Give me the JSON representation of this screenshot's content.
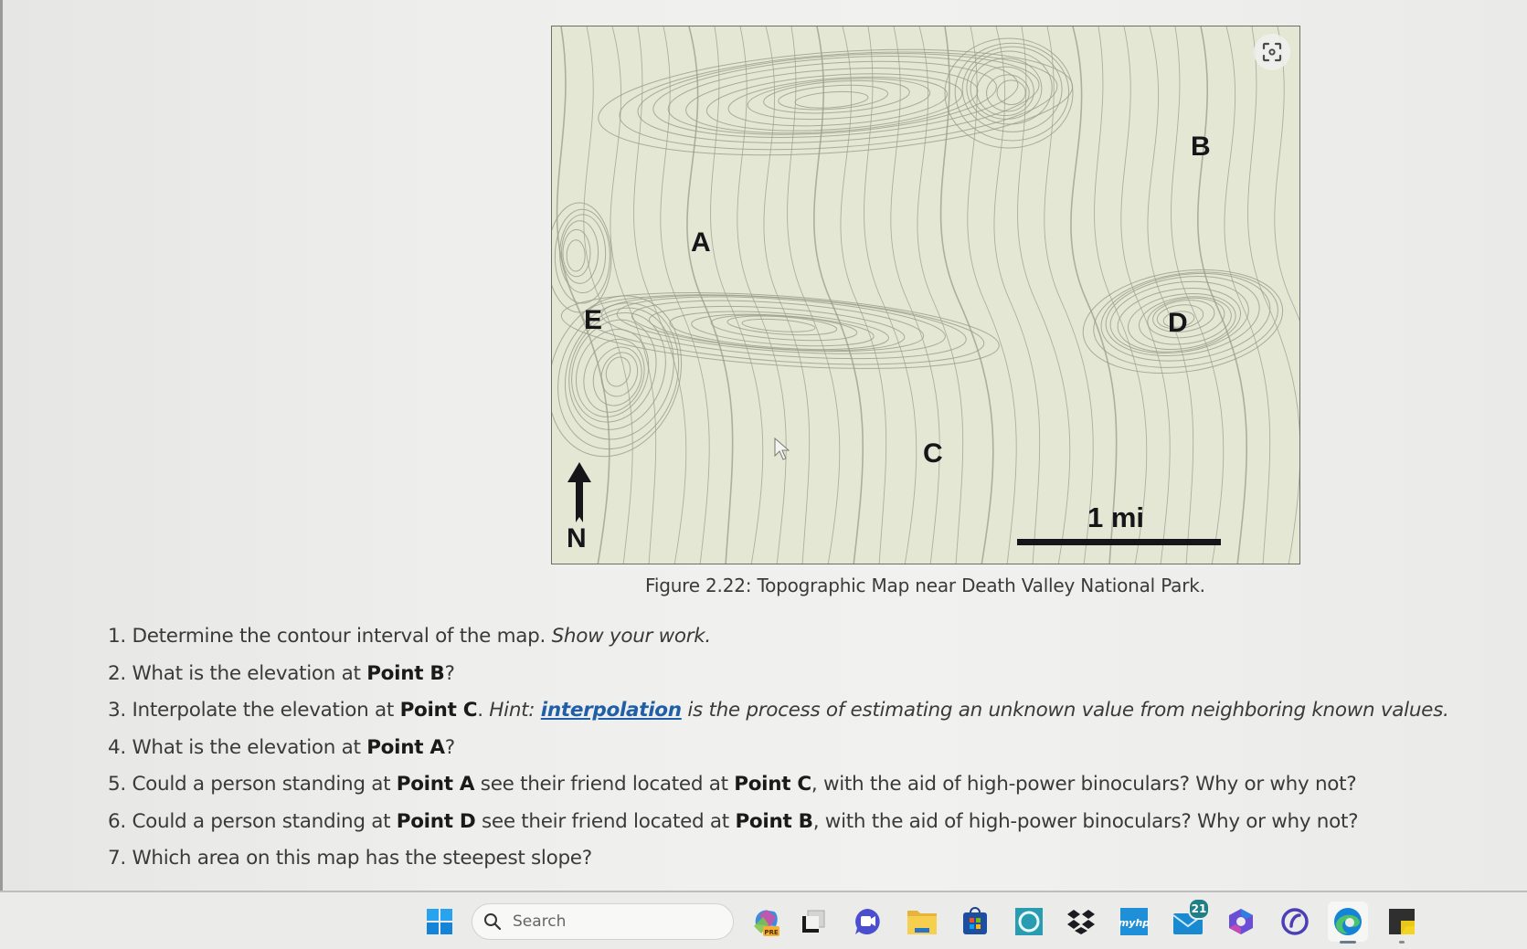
{
  "figure": {
    "caption": "Figure 2.22: Topographic Map near Death Valley National Park.",
    "point_labels": {
      "A": "A",
      "B": "B",
      "C": "C",
      "D": "D",
      "E": "E"
    },
    "north_label": "N",
    "scale_label": "1 mi",
    "colors": {
      "map_background": "#e4e7d3",
      "contour": "#9a9c8c",
      "label": "#16161a"
    }
  },
  "questions": [
    {
      "number": "1.",
      "parts": [
        {
          "t": "Determine the contour interval of the map. "
        },
        {
          "t": "Show your work.",
          "style": "italic"
        }
      ]
    },
    {
      "number": "2.",
      "parts": [
        {
          "t": "What is the elevation at "
        },
        {
          "t": "Point B",
          "style": "bold"
        },
        {
          "t": "?"
        }
      ]
    },
    {
      "number": "3.",
      "parts": [
        {
          "t": "Interpolate the elevation at "
        },
        {
          "t": "Point C",
          "style": "bold"
        },
        {
          "t": ". "
        },
        {
          "t": "Hint: ",
          "style": "italic"
        },
        {
          "t": "interpolation",
          "style": "link"
        },
        {
          "t": " is the process of estimating an unknown value from neighboring known values.",
          "style": "italic"
        }
      ]
    },
    {
      "number": "4.",
      "parts": [
        {
          "t": "What is the elevation at "
        },
        {
          "t": "Point A",
          "style": "bold"
        },
        {
          "t": "?"
        }
      ]
    },
    {
      "number": "5.",
      "parts": [
        {
          "t": "Could a person standing at "
        },
        {
          "t": "Point A",
          "style": "bold"
        },
        {
          "t": " see their friend located at "
        },
        {
          "t": "Point C",
          "style": "bold"
        },
        {
          "t": ", with the aid of high-power binoculars? Why or why not?"
        }
      ]
    },
    {
      "number": "6.",
      "parts": [
        {
          "t": "Could a person standing at "
        },
        {
          "t": "Point D",
          "style": "bold"
        },
        {
          "t": " see their friend located at "
        },
        {
          "t": "Point B",
          "style": "bold"
        },
        {
          "t": ", with the aid of high-power binoculars? Why or why not?"
        }
      ]
    },
    {
      "number": "7.",
      "parts": [
        {
          "t": "Which area on this map has the steepest slope?"
        }
      ]
    }
  ],
  "taskbar": {
    "search_placeholder": "Search",
    "apps": [
      {
        "name": "copilot-pre",
        "icon": "copilot-icon",
        "badge_text": "PRE"
      },
      {
        "name": "task-view",
        "icon": "task-view-icon"
      },
      {
        "name": "teams-meet",
        "icon": "video-chat-icon"
      },
      {
        "name": "file-explorer",
        "icon": "folder-icon"
      },
      {
        "name": "microsoft-store",
        "icon": "store-icon"
      },
      {
        "name": "alexa",
        "icon": "alexa-icon"
      },
      {
        "name": "dropbox",
        "icon": "dropbox-icon"
      },
      {
        "name": "myhp",
        "icon": "myhp-icon",
        "label": "myhp"
      },
      {
        "name": "mail",
        "icon": "mail-icon",
        "badge": "21"
      },
      {
        "name": "microsoft-365",
        "icon": "m365-icon"
      },
      {
        "name": "mcafee-like",
        "icon": "circle-check-icon"
      },
      {
        "name": "edge",
        "icon": "edge-icon",
        "active": true
      },
      {
        "name": "sticky-notes",
        "icon": "sticky-notes-icon",
        "running": true
      }
    ],
    "colors": {
      "windows_blue": "#1a8fe0",
      "badge": "#1e7f86"
    }
  }
}
